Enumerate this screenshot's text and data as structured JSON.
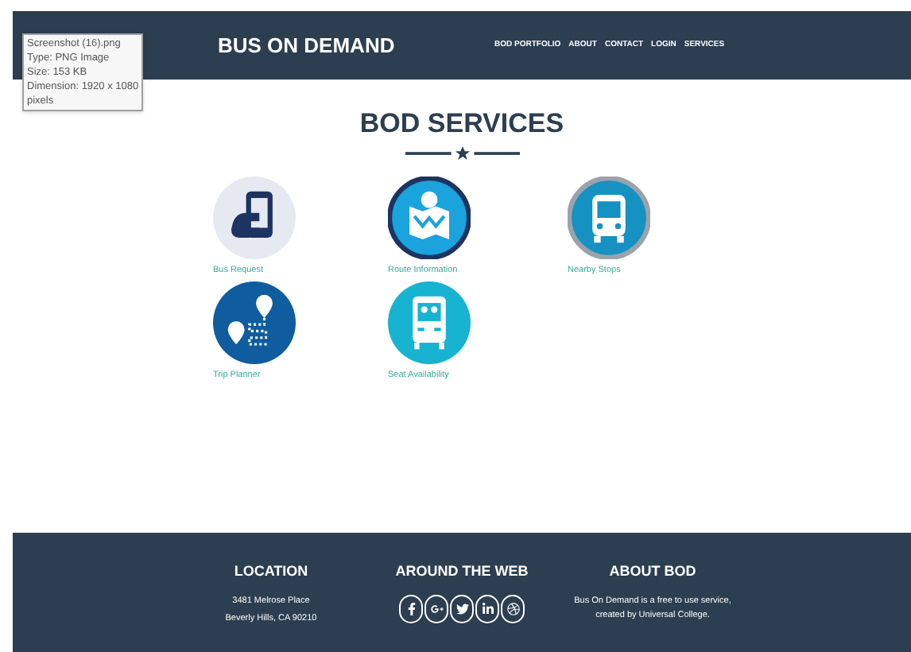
{
  "header": {
    "brand": "BUS ON DEMAND",
    "nav": [
      {
        "label": "BOD PORTFOLIO"
      },
      {
        "label": "ABOUT"
      },
      {
        "label": "CONTACT"
      },
      {
        "label": "LOGIN"
      },
      {
        "label": "SERVICES"
      }
    ]
  },
  "tooltip": {
    "lines": [
      "Screenshot (16).png",
      "Type: PNG Image",
      "Size: 153 KB",
      "Dimension: 1920 x 1080",
      "pixels"
    ]
  },
  "services": {
    "title": "BOD SERVICES",
    "items": [
      {
        "label": "Bus Request",
        "kind": "phone"
      },
      {
        "label": "Route Information",
        "kind": "map"
      },
      {
        "label": "Nearby Stops",
        "kind": "bus"
      },
      {
        "label": "Trip Planner",
        "kind": "route"
      },
      {
        "label": "Seat Availability",
        "kind": "seats"
      }
    ]
  },
  "footer": {
    "location": {
      "heading": "LOCATION",
      "lines": [
        "3481 Melrose Place",
        "Beverly Hills, CA 90210"
      ]
    },
    "web": {
      "heading": "AROUND THE WEB",
      "links": [
        {
          "kind": "facebook"
        },
        {
          "kind": "google"
        },
        {
          "kind": "twitter"
        },
        {
          "kind": "linkedin"
        },
        {
          "kind": "dribbble"
        }
      ]
    },
    "about": {
      "heading": "ABOUT BOD",
      "text": "Bus On Demand is a free to use service, created by Universal College."
    }
  }
}
